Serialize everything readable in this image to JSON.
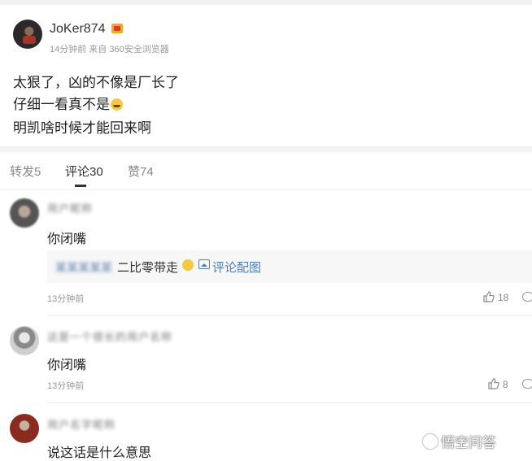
{
  "post": {
    "username": "JoKer874",
    "meta": "14分钟前 来自 360安全浏览器",
    "lines": [
      "太狠了，凶的不像是厂长了",
      "仔细一看真不是",
      "明凯啥时候才能回来啊"
    ]
  },
  "tabs": [
    {
      "label": "转发5"
    },
    {
      "label": "评论30",
      "active": true
    },
    {
      "label": "赞74"
    }
  ],
  "comments": [
    {
      "name": "用户昵称",
      "text": "你闭嘴",
      "quote": {
        "blurred": "某某某某某",
        "text": "二比零带走",
        "link": "评论配图"
      },
      "time": "13分钟前",
      "likes": "18"
    },
    {
      "name": "这是一个很长的用户名称",
      "text": "你闭嘴",
      "time": "13分钟前",
      "likes": "8"
    },
    {
      "name": "用户名字昵称",
      "text": "说这话是什么意思"
    }
  ],
  "watermark": "悟空问答",
  "icons": {
    "like": "thumbs-up-icon",
    "reply": "comment-icon",
    "image": "image-icon",
    "emoji": "laughing-emoji-icon"
  },
  "colors": {
    "link": "#4a7fc1",
    "muted": "#999999"
  }
}
